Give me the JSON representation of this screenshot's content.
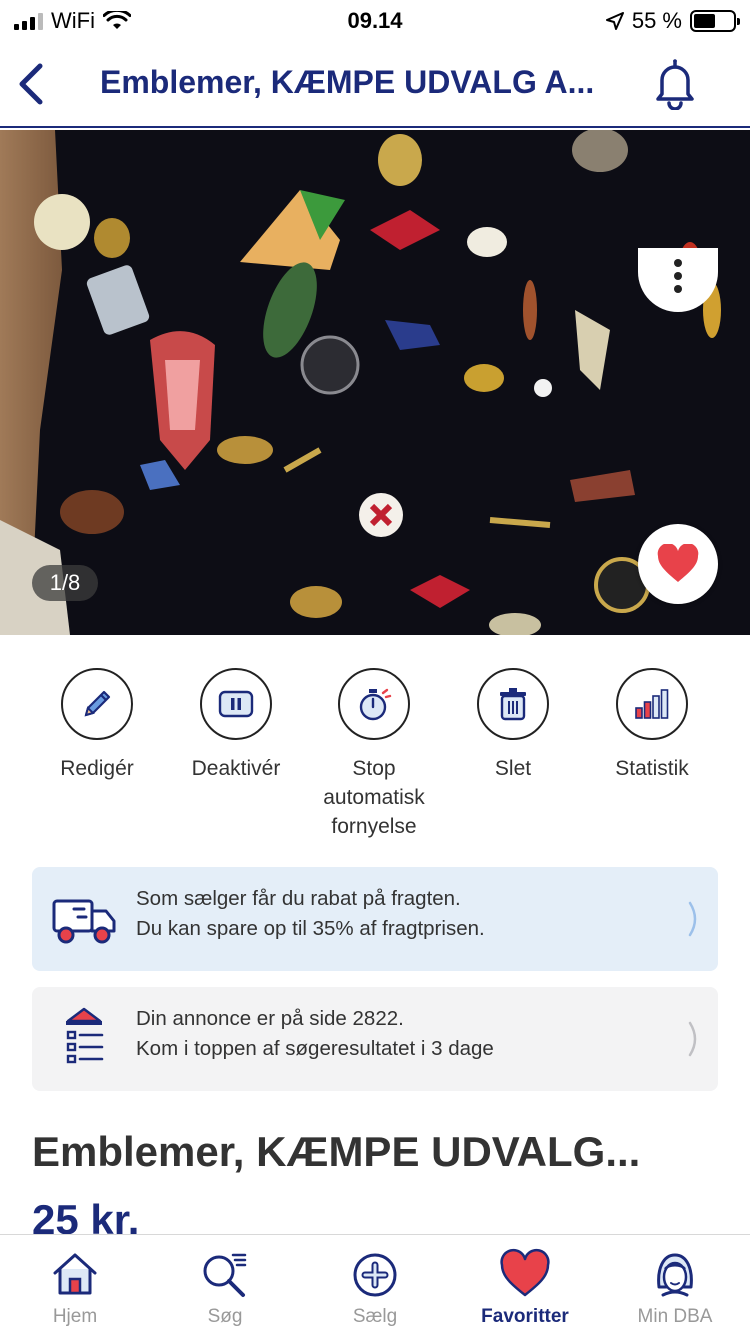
{
  "status_bar": {
    "carrier": "WiFi",
    "time": "09.14",
    "battery_percent": "55 %",
    "battery_level": 0.55
  },
  "nav": {
    "title": "Emblemer, KÆMPE UDVALG A..."
  },
  "gallery": {
    "counter": "1/8"
  },
  "actions": [
    {
      "label": "Redigér",
      "icon": "pencil-icon"
    },
    {
      "label": "Deaktivér",
      "icon": "pause-icon"
    },
    {
      "label": "Stop automatisk fornyelse",
      "icon": "stopwatch-icon"
    },
    {
      "label": "Slet",
      "icon": "trash-icon"
    },
    {
      "label": "Statistik",
      "icon": "bar-chart-icon"
    }
  ],
  "cards": {
    "shipping": {
      "line1": "Som sælger får du rabat på fragten.",
      "line2": "Du kan spare op til 35% af fragtprisen."
    },
    "position": {
      "line1": "Din annonce er på side 2822.",
      "line2": "Kom i toppen af søgeresultatet i 3 dage"
    }
  },
  "listing": {
    "title": "Emblemer, KÆMPE UDVALG...",
    "price": "25 kr."
  },
  "tabs": [
    {
      "label": "Hjem",
      "icon": "home-icon",
      "active": false
    },
    {
      "label": "Søg",
      "icon": "search-icon",
      "active": false
    },
    {
      "label": "Sælg",
      "icon": "plus-circle-icon",
      "active": false
    },
    {
      "label": "Favoritter",
      "icon": "heart-icon",
      "active": true
    },
    {
      "label": "Min DBA",
      "icon": "profile-icon",
      "active": false
    }
  ],
  "colors": {
    "brand_navy": "#1b2a7a",
    "heart_red": "#e8424a",
    "info_blue_bg": "#e4eef8",
    "info_grey_bg": "#f3f3f4"
  }
}
